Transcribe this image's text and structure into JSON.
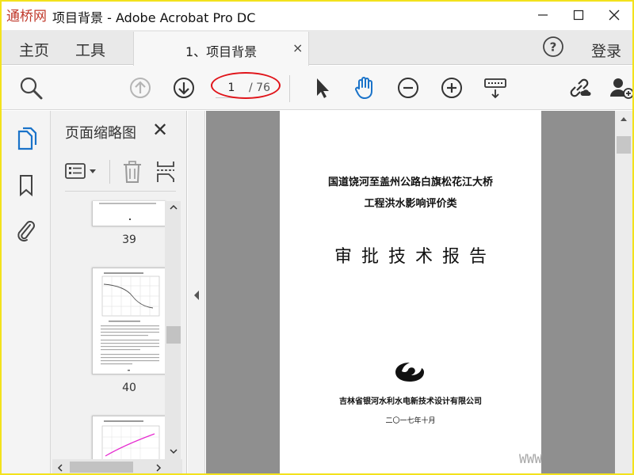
{
  "window": {
    "title": "项目背景 - Adobe Acrobat Pro DC",
    "logo_text": "通桥网"
  },
  "nav": {
    "home": "主页",
    "tools": "工具",
    "login": "登录"
  },
  "tab": {
    "label": "1、项目背景",
    "close": "×"
  },
  "toolbar": {
    "page_current": "1",
    "page_total": "/ 76"
  },
  "thumbnails": {
    "title": "页面缩略图",
    "close": "✕",
    "pages": [
      {
        "number": "39"
      },
      {
        "number": "40"
      }
    ]
  },
  "document": {
    "title_line1": "国道饶河至盖州公路白旗松花江大桥",
    "title_line2": "工程洪水影响评价类",
    "title_line3": "审批技术报告",
    "organization": "吉林省银河水利水电新技术设计有限公司",
    "date": "二〇一七年十月"
  },
  "watermark": "WWW",
  "colors": {
    "accent_blue": "#1a73c9",
    "annotation_red": "#e0141a",
    "frame_yellow": "#f3e21c"
  },
  "icons": [
    "search-icon",
    "arrow-up-icon",
    "arrow-down-icon",
    "pointer-icon",
    "hand-icon",
    "zoom-out-icon",
    "zoom-in-icon",
    "keyboard-icon",
    "share-link-icon",
    "add-user-icon",
    "pages-icon",
    "bookmark-icon",
    "paperclip-icon",
    "help-icon"
  ]
}
